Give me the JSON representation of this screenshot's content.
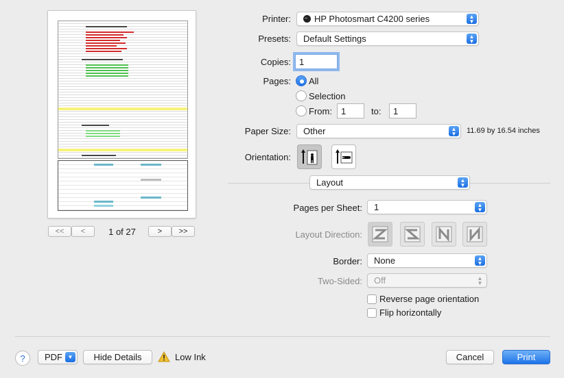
{
  "preview": {
    "page_indicator": "1 of 27"
  },
  "pager": {
    "first": "<<",
    "prev": "<",
    "next": ">",
    "last": ">>"
  },
  "printer": {
    "label": "Printer:",
    "value": "HP Photosmart C4200 series"
  },
  "presets": {
    "label": "Presets:",
    "value": "Default Settings"
  },
  "copies": {
    "label": "Copies:",
    "value": "1"
  },
  "pages": {
    "label": "Pages:",
    "all": "All",
    "selection": "Selection",
    "from_label": "From:",
    "from_value": "1",
    "to_label": "to:",
    "to_value": "1"
  },
  "paper_size": {
    "label": "Paper Size:",
    "value": "Other",
    "dimensions": "11.69 by 16.54 inches"
  },
  "orientation": {
    "label": "Orientation:"
  },
  "section": {
    "value": "Layout"
  },
  "pages_per_sheet": {
    "label": "Pages per Sheet:",
    "value": "1"
  },
  "layout_direction": {
    "label": "Layout Direction:"
  },
  "border": {
    "label": "Border:",
    "value": "None"
  },
  "two_sided": {
    "label": "Two-Sided:",
    "value": "Off"
  },
  "options": {
    "reverse": "Reverse page orientation",
    "flip": "Flip horizontally"
  },
  "footer": {
    "help": "?",
    "pdf": "PDF",
    "hide_details": "Hide Details",
    "low_ink": "Low Ink",
    "cancel": "Cancel",
    "print": "Print"
  },
  "colors": {
    "accent": "#1e73e8",
    "highlight": "#f7f37a",
    "red_text": "#d22a2a",
    "green_text": "#4fbf4f"
  },
  "icons": [
    "printer-status-icon",
    "popup-arrows-icon",
    "portrait-icon",
    "landscape-icon",
    "warning-icon",
    "dropdown-arrow-icon"
  ]
}
